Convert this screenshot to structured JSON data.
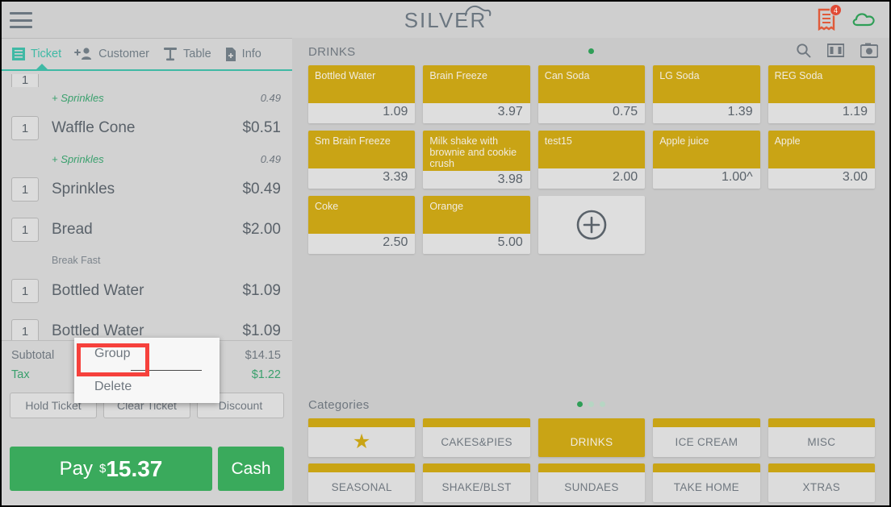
{
  "topbar": {
    "brand": "SILVER",
    "menu_icon": "hamburger-icon",
    "receipt_icon": "receipt-icon",
    "receipt_badge": "4",
    "cloud_icon": "cloud-icon",
    "badge_color": "#e14b36",
    "cloud_color": "#2f9e57"
  },
  "tabs": [
    {
      "label": "Ticket",
      "icon": "ticket-icon",
      "active": true
    },
    {
      "label": "Customer",
      "icon": "add-person-icon",
      "active": false
    },
    {
      "label": "Table",
      "icon": "table-icon",
      "active": false
    },
    {
      "label": "Info",
      "icon": "info-file-icon",
      "active": false
    }
  ],
  "ticket": {
    "partial_top_item": {
      "qty": "1",
      "name": "",
      "price": ""
    },
    "items": [
      {
        "qty": "1",
        "name": "Waffle Cone",
        "price": "$0.51",
        "mod": {
          "name": "+ Sprinkles",
          "price": "0.49",
          "style": "italic-green"
        }
      },
      {
        "qty": "1",
        "name": "Sprinkles",
        "price": "$0.49"
      },
      {
        "qty": "1",
        "name": "Bread",
        "price": "$2.00",
        "mod": {
          "name": "Break Fast",
          "price": "",
          "style": "plain-gray"
        }
      },
      {
        "qty": "1",
        "name": "Bottled Water",
        "price": "$1.09"
      },
      {
        "qty": "1",
        "name": "Bottled Water",
        "price": "$1.09"
      }
    ],
    "top_modifier": {
      "name": "+ Sprinkles",
      "price": "0.49"
    },
    "subtotal_label": "Subtotal",
    "subtotal_value": "$14.15",
    "tax_label": "Tax",
    "tax_value": "$1.22",
    "actions": [
      "Hold Ticket",
      "Clear Ticket",
      "Discount"
    ],
    "pay_label": "Pay",
    "pay_currency": "$",
    "pay_amount": "15.37",
    "cash_label": "Cash"
  },
  "context_menu": {
    "items": [
      "Group",
      "Delete"
    ],
    "highlighted": "Group",
    "highlight_color": "#f6413c"
  },
  "products": {
    "title": "DRINKS",
    "dots": {
      "count": 1,
      "active": 0
    },
    "icons": [
      "search-icon",
      "columns-icon",
      "camera-icon"
    ],
    "tiles": [
      {
        "name": "Bottled Water",
        "price": "1.09"
      },
      {
        "name": "Brain Freeze",
        "price": "3.97"
      },
      {
        "name": "Can Soda",
        "price": "0.75"
      },
      {
        "name": "LG Soda",
        "price": "1.39"
      },
      {
        "name": "REG Soda",
        "price": "1.19"
      },
      {
        "name": "Sm Brain Freeze",
        "price": "3.39"
      },
      {
        "name": "Milk shake with brownie and cookie crush",
        "price": "3.98"
      },
      {
        "name": "test15",
        "price": "2.00"
      },
      {
        "name": "Apple juice",
        "price": "1.00^"
      },
      {
        "name": "Apple",
        "price": "3.00"
      },
      {
        "name": "Coke",
        "price": "2.50"
      },
      {
        "name": "Orange",
        "price": "5.00"
      }
    ],
    "add_tile_icon": "plus-circle-icon"
  },
  "categories": {
    "title": "Categories",
    "dots": {
      "count": 3,
      "active": 0
    },
    "items": [
      {
        "label": "",
        "icon": "star-icon",
        "selected": false
      },
      {
        "label": "CAKES&PIES",
        "selected": false
      },
      {
        "label": "DRINKS",
        "selected": true
      },
      {
        "label": "ICE CREAM",
        "selected": false
      },
      {
        "label": "MISC",
        "selected": false
      },
      {
        "label": "SEASONAL",
        "selected": false
      },
      {
        "label": "SHAKE/BLST",
        "selected": false
      },
      {
        "label": "SUNDAES",
        "selected": false
      },
      {
        "label": "TAKE HOME",
        "selected": false
      },
      {
        "label": "XTRAS",
        "selected": false
      }
    ]
  },
  "colors": {
    "gold": "#c9a415",
    "teal": "#3fb9a5",
    "green": "#3aaa5c",
    "gray_text": "#6f777f"
  }
}
